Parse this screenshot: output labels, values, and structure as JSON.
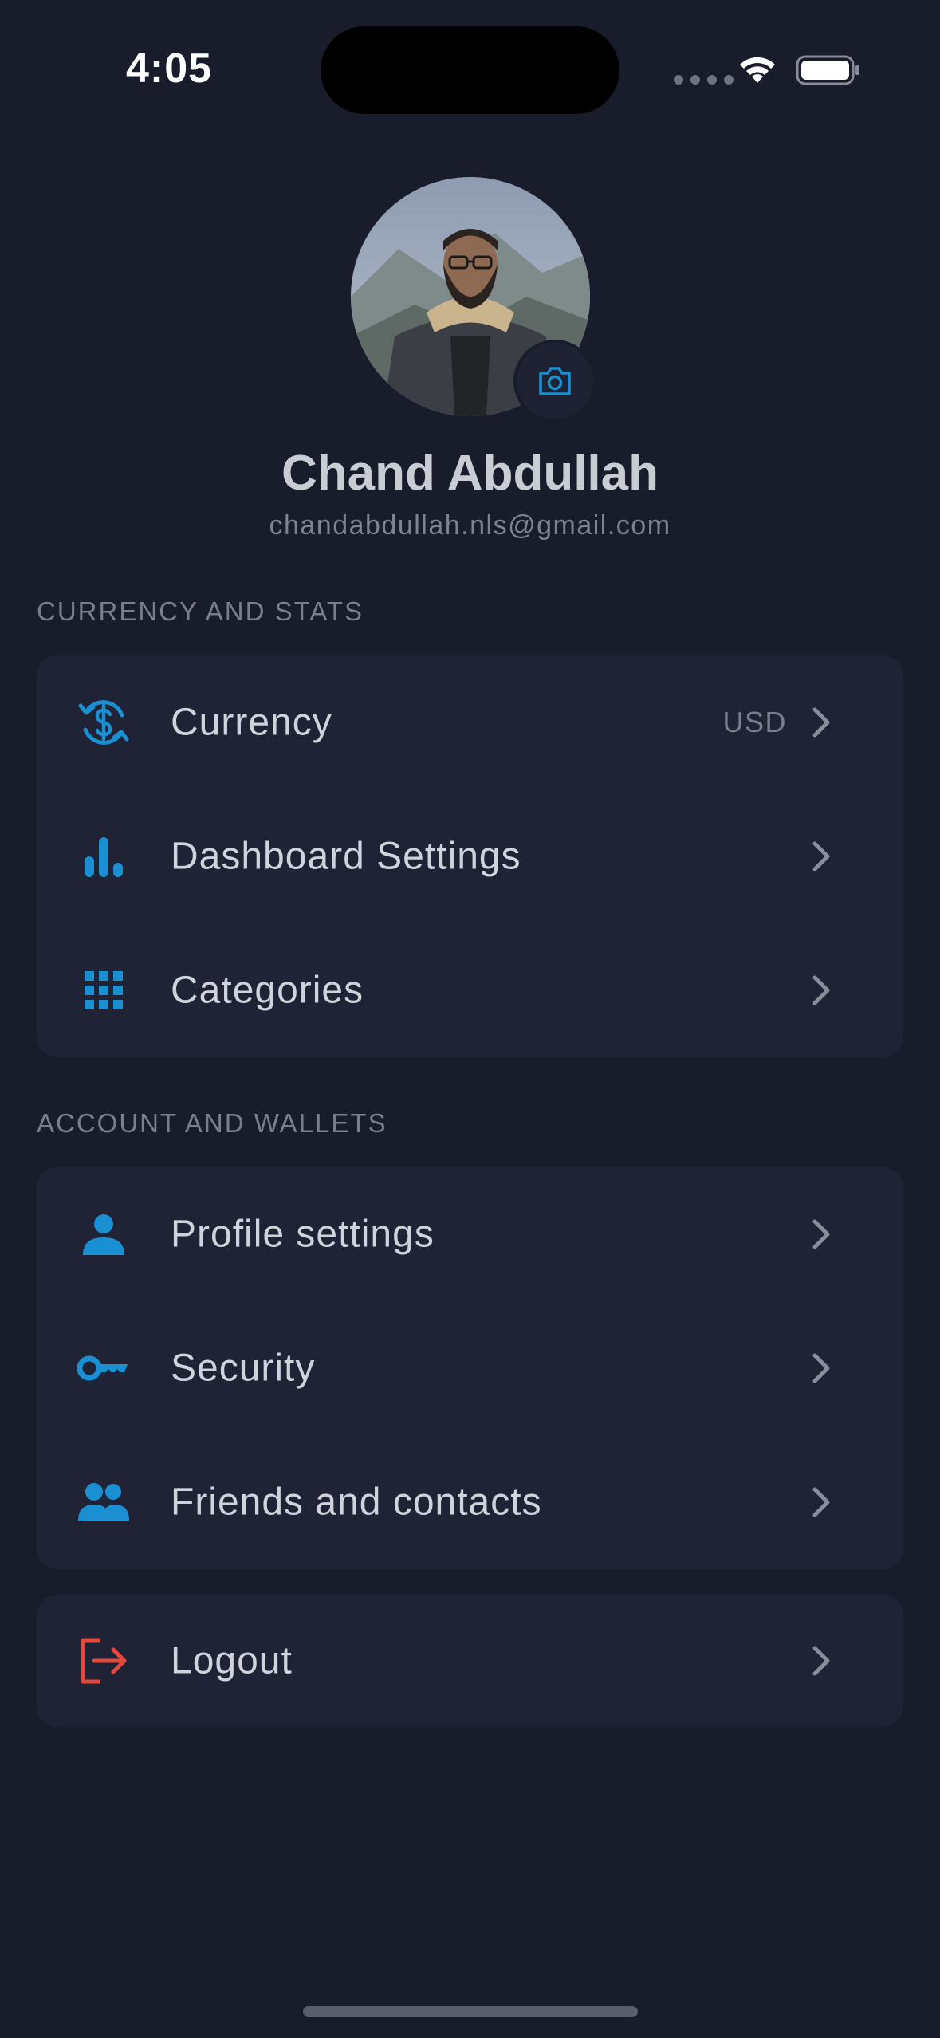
{
  "status_bar": {
    "time": "4:05"
  },
  "profile": {
    "name": "Chand Abdullah",
    "email": "chandabdullah.nls@gmail.com",
    "avatar_icon": "avatar-photo",
    "camera_icon": "camera-icon"
  },
  "sections": {
    "currency_stats": {
      "title": "CURRENCY AND STATS",
      "items": [
        {
          "label": "Currency",
          "value": "USD",
          "icon": "currency-exchange-icon"
        },
        {
          "label": "Dashboard Settings",
          "icon": "bar-chart-icon"
        },
        {
          "label": "Categories",
          "icon": "grid-icon"
        }
      ]
    },
    "account_wallets": {
      "title": "ACCOUNT AND WALLETS",
      "items": [
        {
          "label": "Profile settings",
          "icon": "person-icon"
        },
        {
          "label": "Security",
          "icon": "key-icon"
        },
        {
          "label": "Friends and contacts",
          "icon": "people-icon"
        }
      ]
    },
    "logout": {
      "label": "Logout",
      "icon": "logout-icon"
    }
  },
  "colors": {
    "background": "#181c2b",
    "card": "#1f2335",
    "accent": "#1a8fd1",
    "danger": "#e5493d",
    "text_primary": "#d0d3db",
    "text_secondary": "#7b7f8c"
  }
}
